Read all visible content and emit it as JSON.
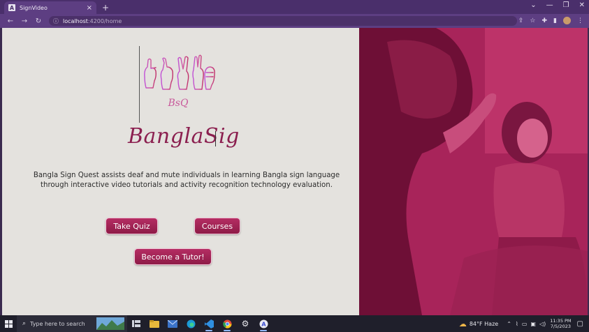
{
  "browser": {
    "tab_title": "SignVideo",
    "tab_favicon": "A",
    "tab_close": "×",
    "new_tab": "+",
    "url_host": "localhost",
    "url_path": ":4200/home",
    "window_controls": [
      "⌄",
      "—",
      "❐",
      "✕"
    ]
  },
  "page": {
    "brand_text": "BanglaSig",
    "logo_caption": "BsQ",
    "description_line1": "Bangla Sign Quest assists deaf and mute individuals in learning Bangla sign language",
    "description_line2": "through interactive video tutorials and activity recognition technology evaluation.",
    "buttons": {
      "take_quiz": "Take Quiz",
      "courses": "Courses",
      "become_tutor": "Become a Tutor!"
    },
    "colors": {
      "accent": "#8b1f4f",
      "button": "#a82559",
      "photo_tint": "#b82a5f"
    }
  },
  "taskbar": {
    "search_placeholder": "Type here to search",
    "weather": "84°F  Haze",
    "time": "11:35 PM",
    "date": "7/5/2023"
  }
}
